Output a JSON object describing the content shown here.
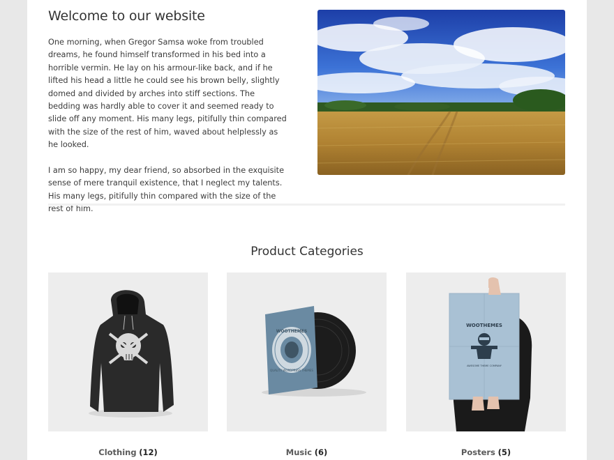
{
  "welcome": {
    "title": "Welcome to our website",
    "paragraph_1": "One morning, when Gregor Samsa woke from troubled dreams, he found himself transformed in his bed into a horrible vermin. He lay on his armour-like back, and if he lifted his head a little he could see his brown belly, slightly domed and divided by arches into stiff sections. The bedding was hardly able to cover it and seemed ready to slide off any moment. His many legs, pitifully thin compared with the size of the rest of him, waved about helplessly as he looked.",
    "paragraph_2": "I am so happy, my dear friend, so absorbed in the exquisite sense of mere tranquil existence, that I neglect my talents. His many legs, pitifully thin compared with the size of the rest of him."
  },
  "product_categories": {
    "title": "Product Categories",
    "items": [
      {
        "name": "Clothing",
        "count": "(12)",
        "icon": "hoodie-image"
      },
      {
        "name": "Music",
        "count": "(6)",
        "icon": "vinyl-record-image"
      },
      {
        "name": "Posters",
        "count": "(5)",
        "icon": "poster-image"
      }
    ],
    "logo_texts": {
      "music_ring": "WOOTHEMES",
      "music_ring_bottom": "QUALITY WORDPRESS THEMES",
      "poster_title": "WOOTHEMES",
      "poster_sub": "AWESOME THEME COMPANY"
    }
  },
  "colors": {
    "page_background": "#e8e8e8",
    "content_background": "#ffffff",
    "tile_background": "#ededed",
    "heading": "#333333"
  }
}
